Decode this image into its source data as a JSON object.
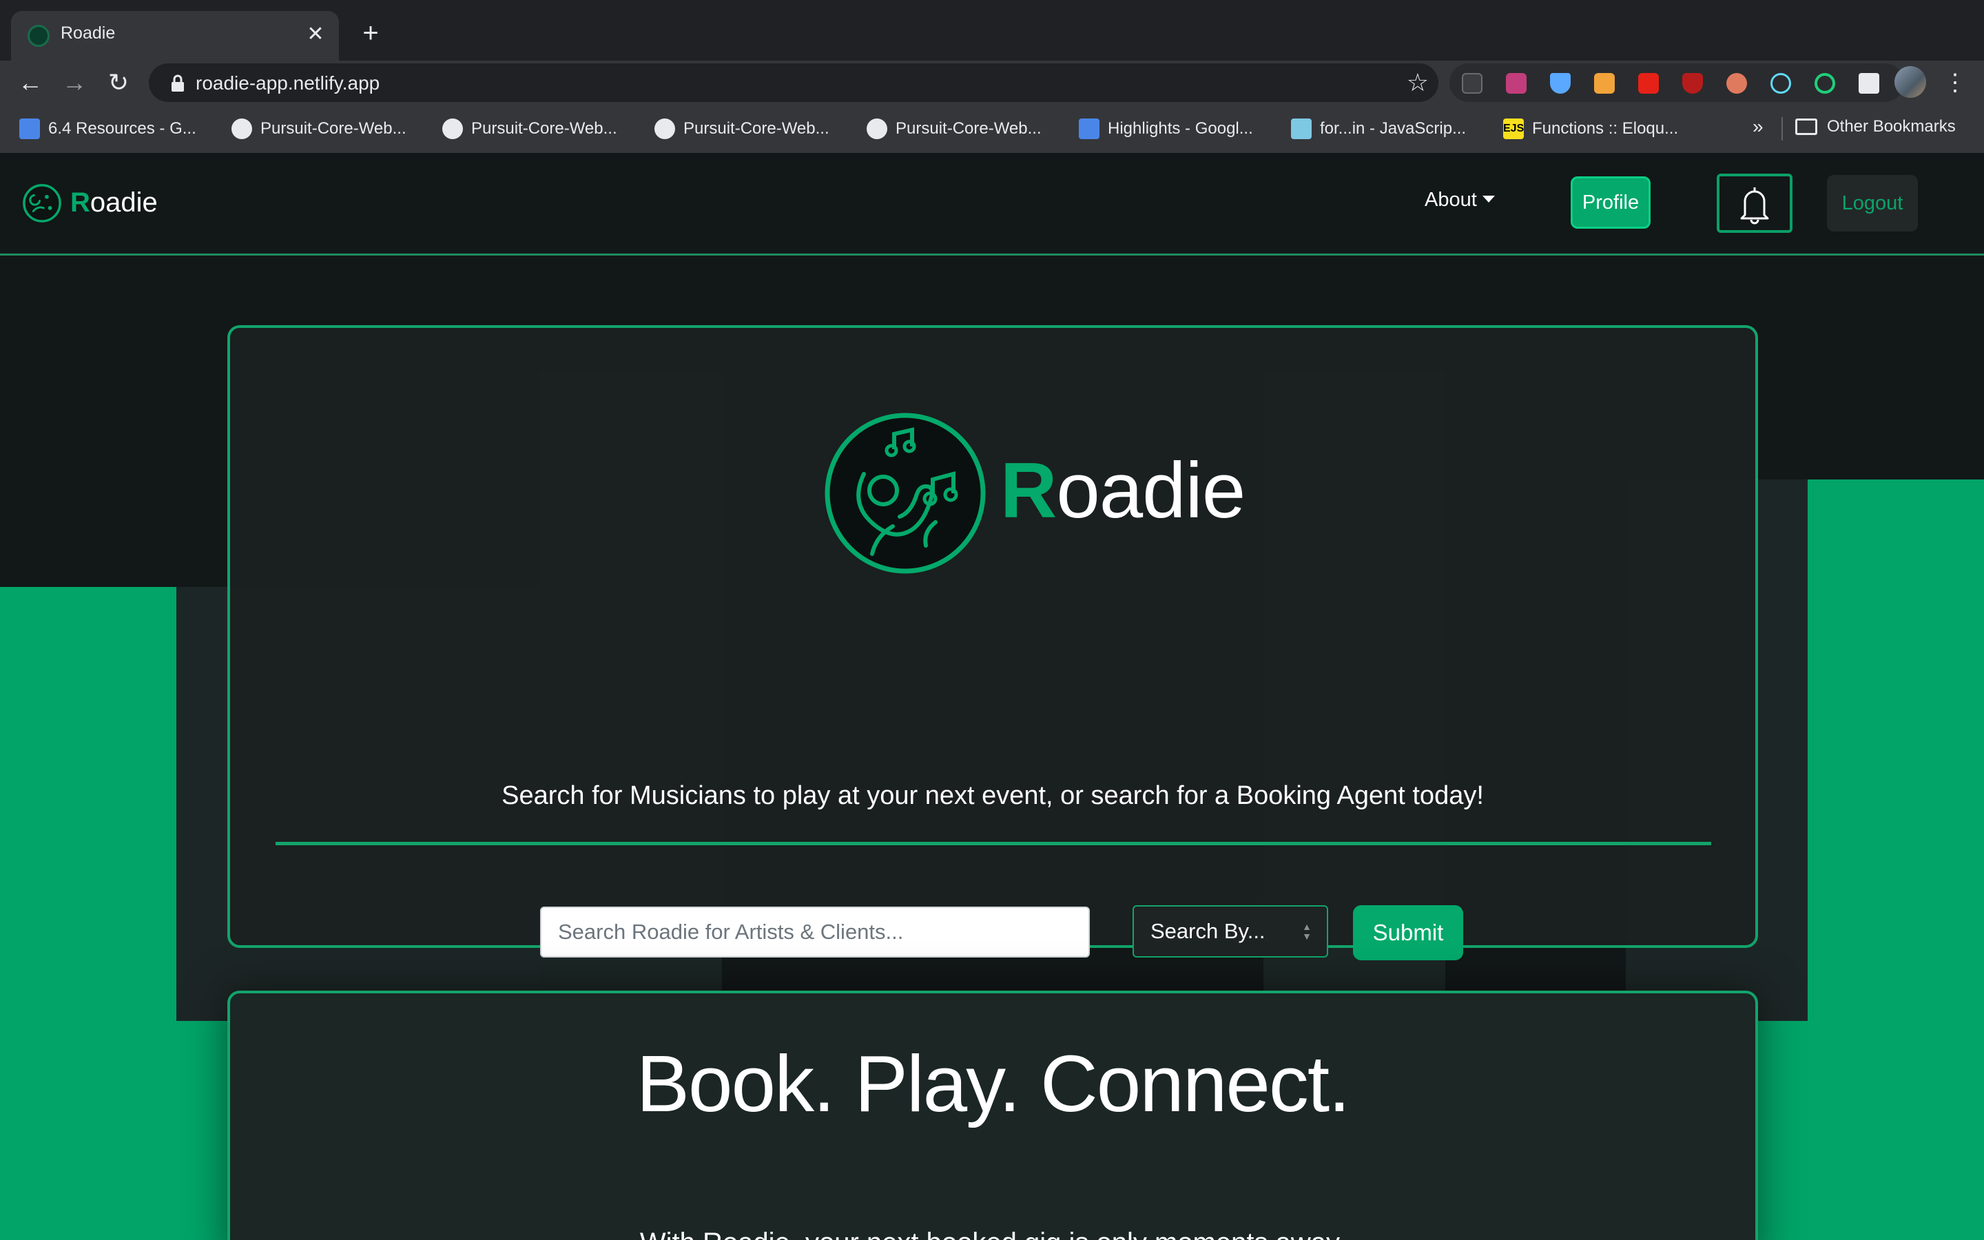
{
  "browser": {
    "tab_title": "Roadie",
    "url": "roadie-app.netlify.app",
    "bookmarks": [
      {
        "label": "6.4 Resources - G...",
        "icon": "google-docs-icon"
      },
      {
        "label": "Pursuit-Core-Web...",
        "icon": "github-icon"
      },
      {
        "label": "Pursuit-Core-Web...",
        "icon": "github-icon"
      },
      {
        "label": "Pursuit-Core-Web...",
        "icon": "github-icon"
      },
      {
        "label": "Pursuit-Core-Web...",
        "icon": "github-icon"
      },
      {
        "label": "Highlights - Googl...",
        "icon": "google-docs-icon"
      },
      {
        "label": "for...in - JavaScrip...",
        "icon": "mdn-icon"
      },
      {
        "label": "Functions :: Eloqu...",
        "icon": "ejs-icon"
      }
    ],
    "more_bookmarks": "»",
    "other_bookmarks": "Other Bookmarks"
  },
  "nav": {
    "brand_first": "R",
    "brand_rest": "oadie",
    "about": "About",
    "profile": "Profile",
    "logout": "Logout"
  },
  "hero": {
    "brand_first": "R",
    "brand_rest": "oadie",
    "subtitle": "Search for Musicians to play at your next event, or search for a Booking Agent today!",
    "search_placeholder": "Search Roadie for Artists & Clients...",
    "search_by": "Search By...",
    "submit": "Submit"
  },
  "info": {
    "heading": "Book. Play. Connect.",
    "body": "With Roadie, your next booked gig is only moments away."
  },
  "colors": {
    "accent": "#04a96b",
    "background": "#121717",
    "panel": "#1b2625"
  }
}
